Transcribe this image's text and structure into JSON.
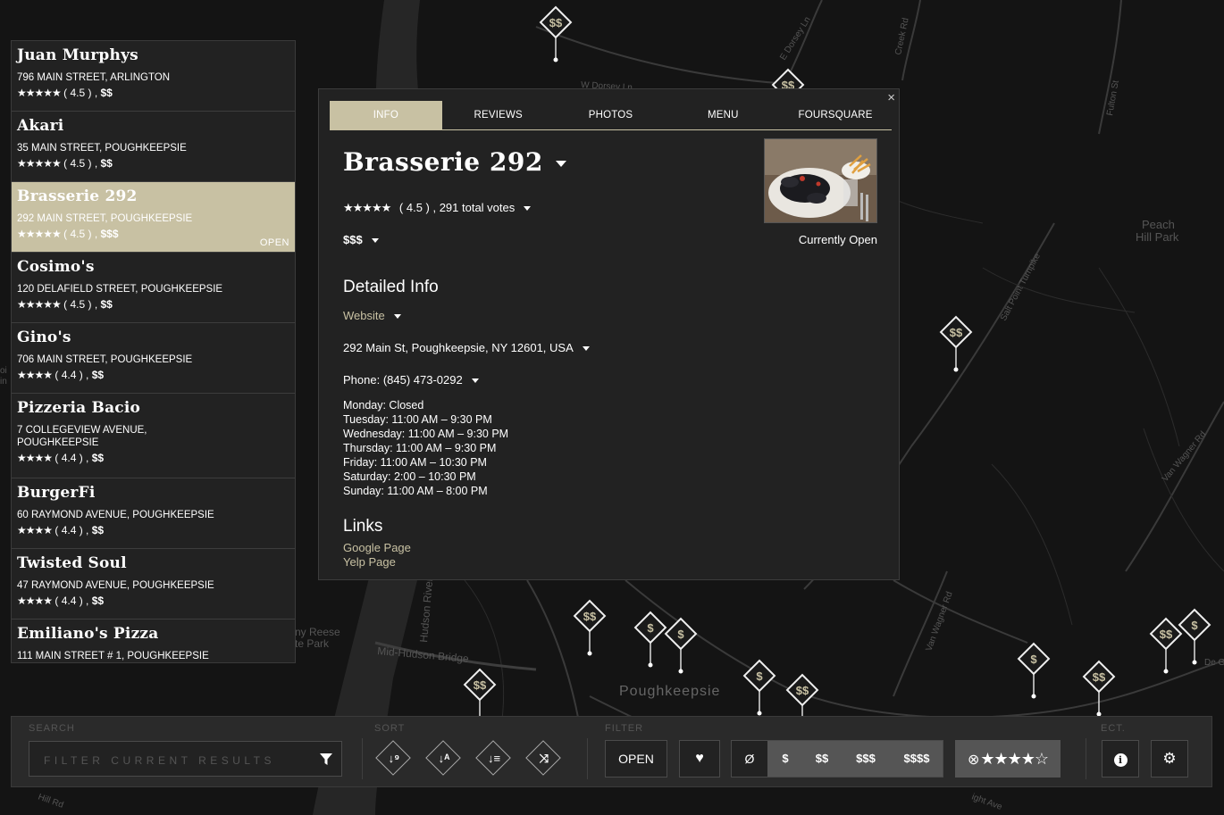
{
  "map": {
    "place_labels": [
      "Peach\nHill Park",
      "Poughkeepsie",
      "Hudson River",
      "Mid-Hudson Bridge",
      "ny Reese\nte Park"
    ],
    "road_labels": [
      "W Dorsey Ln",
      "E Dorsey Ln",
      "Creek Rd",
      "Salt Point Turnpike",
      "Van Wagner Rd",
      "Van Wagner Rd",
      "Fulton St",
      "De Ga",
      "Hill Rd",
      "ight Ave",
      "oi",
      "in"
    ],
    "marker_labels": [
      "$$",
      "$$",
      "$$",
      "$$",
      "$",
      "$",
      "$$",
      "$",
      "$$",
      "$$",
      "$$",
      "$",
      "$"
    ]
  },
  "results": [
    {
      "name": "Juan Murphys",
      "address": "796 MAIN STREET, ARLINGTON",
      "stars": "★★★★★",
      "rating": "( 4.5 ) ,",
      "price": "$$",
      "open": "",
      "selected": false
    },
    {
      "name": "Akari",
      "address": "35 MAIN STREET, POUGHKEEPSIE",
      "stars": "★★★★★",
      "rating": "( 4.5 ) ,",
      "price": "$$",
      "open": "",
      "selected": false
    },
    {
      "name": "Brasserie 292",
      "address": "292 MAIN STREET, POUGHKEEPSIE",
      "stars": "★★★★★",
      "rating": "( 4.5 ) ,",
      "price": "$$$",
      "open": "OPEN",
      "selected": true
    },
    {
      "name": "Cosimo's",
      "address": "120 DELAFIELD STREET, POUGHKEEPSIE",
      "stars": "★★★★★",
      "rating": "( 4.5 ) ,",
      "price": "$$",
      "open": "",
      "selected": false
    },
    {
      "name": "Gino's",
      "address": "706 MAIN STREET, POUGHKEEPSIE",
      "stars": "★★★★",
      "rating": "( 4.4 ) ,",
      "price": "$$",
      "open": "",
      "selected": false
    },
    {
      "name": "Pizzeria Bacio",
      "address": "7 COLLEGEVIEW AVENUE, POUGHKEEPSIE",
      "stars": "★★★★",
      "rating": "( 4.4 ) ,",
      "price": "$$",
      "open": "",
      "selected": false
    },
    {
      "name": "BurgerFi",
      "address": "60 RAYMOND AVENUE, POUGHKEEPSIE",
      "stars": "★★★★",
      "rating": "( 4.4 ) ,",
      "price": "$$",
      "open": "",
      "selected": false
    },
    {
      "name": "Twisted Soul",
      "address": "47 RAYMOND AVENUE, POUGHKEEPSIE",
      "stars": "★★★★",
      "rating": "( 4.4 ) ,",
      "price": "$$",
      "open": "",
      "selected": false
    },
    {
      "name": "Emiliano's Pizza",
      "address": "111 MAIN STREET # 1, POUGHKEEPSIE",
      "stars": "",
      "rating": "",
      "price": "",
      "open": "",
      "selected": false
    }
  ],
  "panel": {
    "close": "×",
    "tabs": [
      "INFO",
      "REVIEWS",
      "PHOTOS",
      "MENU",
      "FOURSQUARE"
    ],
    "active_tab": "INFO",
    "name": "Brasserie 292",
    "stars": "★★★★★",
    "rating_text": "( 4.5 ) ,  291 total votes",
    "price": "$$$",
    "open_status": "Currently Open",
    "detailed_heading": "Detailed Info",
    "website": "Website",
    "address": "292 Main St, Poughkeepsie, NY 12601, USA",
    "phone": "Phone: (845) 473-0292",
    "hours": [
      "Monday: Closed",
      "Tuesday: 11:00 AM – 9:30 PM",
      "Wednesday: 11:00 AM – 9:30 PM",
      "Thursday: 11:00 AM – 9:30 PM",
      "Friday: 11:00 AM – 10:30 PM",
      "Saturday: 2:00 – 10:30 PM",
      "Sunday: 11:00 AM – 8:00 PM"
    ],
    "links_heading": "Links",
    "links": [
      "Google Page",
      "Yelp Page"
    ]
  },
  "toolbar": {
    "search_label": "SEARCH",
    "search_placeholder": "FILTER CURRENT RESULTS",
    "sort_label": "SORT",
    "filter_label": "FILTER",
    "ect_label": "ECT.",
    "sort_icons": [
      "sort-numeric-icon",
      "sort-alpha-icon",
      "sort-amount-icon",
      "shuffle-icon"
    ],
    "open_button": "OPEN",
    "price_none": "Ø",
    "price_options": [
      "$",
      "$$",
      "$$$",
      "$$$$"
    ],
    "star_filter": "★★★★☆",
    "star_clear": "⊗"
  },
  "colors": {
    "accent": "#c8c1a3",
    "map_bg": "#141414",
    "panel_bg": "#222222"
  }
}
